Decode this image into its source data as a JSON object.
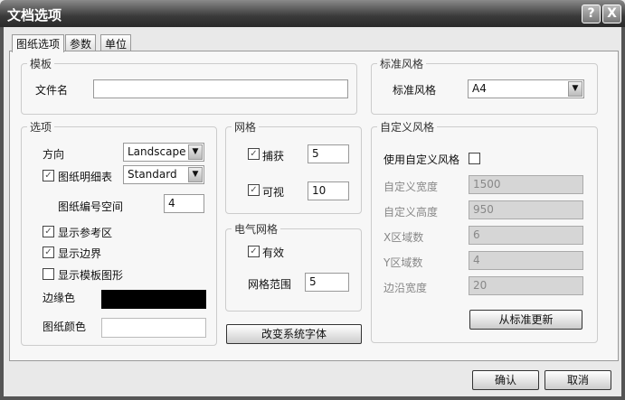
{
  "window": {
    "title": "文档选项",
    "help": "?",
    "close": "X"
  },
  "tabs": [
    "图纸选项",
    "参数",
    "单位"
  ],
  "template": {
    "group": "模板",
    "file_label": "文件名",
    "file_value": ""
  },
  "std_style": {
    "group": "标准风格",
    "label": "标准风格",
    "value": "A4"
  },
  "options": {
    "group": "选项",
    "orientation_label": "方向",
    "orientation_value": "Landscape",
    "title_block_label": "图纸明细表",
    "title_block_value": "Standard",
    "sheet_num_label": "图纸编号空间",
    "sheet_num_value": "4",
    "ref_zones": "显示参考区",
    "border": "显示边界",
    "template_graphics": "显示模板图形",
    "border_color_label": "边缘色",
    "border_color": "#000000",
    "sheet_color_label": "图纸颜色",
    "sheet_color": "#ffffff"
  },
  "grid": {
    "group": "网格",
    "snap_label": "捕获",
    "snap_value": "5",
    "visible_label": "可视",
    "visible_value": "10"
  },
  "elec_grid": {
    "group": "电气网格",
    "enable_label": "有效",
    "range_label": "网格范围",
    "range_value": "5"
  },
  "change_font": "改变系统字体",
  "custom": {
    "group": "自定义风格",
    "use_label": "使用自定义风格",
    "width_label": "自定义宽度",
    "width_value": "1500",
    "height_label": "自定义高度",
    "height_value": "950",
    "x_label": "X区域数",
    "x_value": "6",
    "y_label": "Y区域数",
    "y_value": "4",
    "margin_label": "边沿宽度",
    "margin_value": "20",
    "update": "从标准更新"
  },
  "footer": {
    "ok": "确认",
    "cancel": "取消"
  }
}
